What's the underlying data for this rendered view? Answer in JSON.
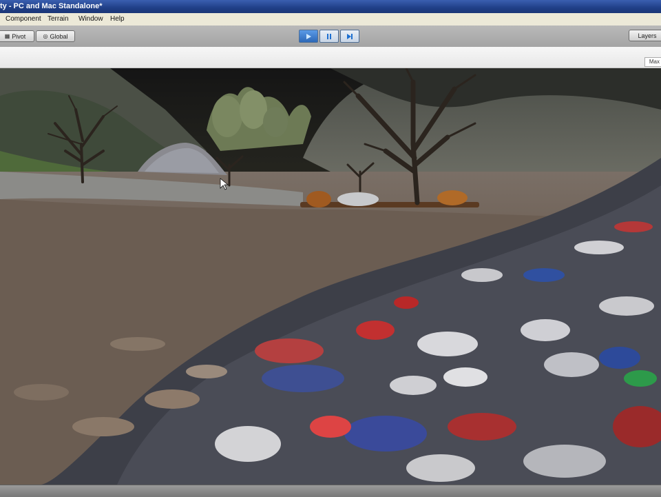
{
  "window": {
    "title": "ty - PC and Mac Standalone*"
  },
  "menu": {
    "items": [
      "Component",
      "Terrain",
      "Window",
      "Help"
    ]
  },
  "toolbar": {
    "pivot_label": "Pivot",
    "global_label": "Global",
    "play_icon": "play-icon",
    "pause_icon": "pause-icon",
    "step_icon": "step-icon",
    "layers_label": "Layers"
  },
  "panel": {
    "maximize_tab_label": "Max"
  },
  "colors": {
    "titlebar": "#203f87",
    "toolbar": "#b0b0b0",
    "play_active": "#3d7fd0"
  }
}
